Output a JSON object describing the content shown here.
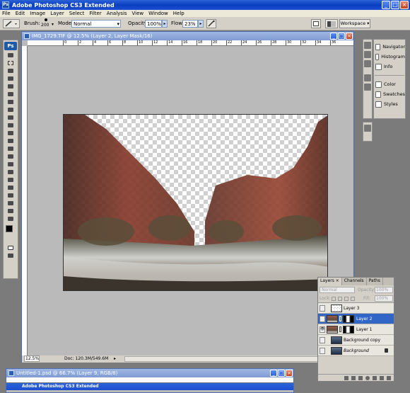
{
  "app": {
    "title": "Adobe Photoshop CS3 Extended",
    "badge": "Ps"
  },
  "window_controls": [
    "_",
    "□",
    "×"
  ],
  "menu": [
    "File",
    "Edit",
    "Image",
    "Layer",
    "Select",
    "Filter",
    "Analysis",
    "View",
    "Window",
    "Help"
  ],
  "options": {
    "brush_label": "Brush:",
    "brush_size": "200",
    "mode_label": "Mode:",
    "mode_value": "Normal",
    "opacity_label": "Opacity:",
    "opacity_value": "100%",
    "flow_label": "Flow:",
    "flow_value": "23%",
    "workspace_label": "Workspace ▾"
  },
  "document": {
    "title": "IMG_1729.TIF @ 12.5% (Layer 2, Layer Mask/16)",
    "zoom": "12.5%",
    "doc_size": "Doc: 120.3M/549.6M",
    "ruler_top": [
      "0",
      "2",
      "4",
      "6",
      "8",
      "10",
      "12",
      "14",
      "16",
      "18",
      "20",
      "22",
      "24",
      "26",
      "28",
      "30",
      "32",
      "34",
      "36"
    ]
  },
  "tools": {
    "badge": "Ps"
  },
  "panels": {
    "items": [
      "Navigator",
      "Histogram",
      "Info",
      "Color",
      "Swatches",
      "Styles"
    ]
  },
  "layers": {
    "tabs": [
      "Layers ×",
      "Channels",
      "Paths"
    ],
    "blend": "Normal",
    "opacity_label": "Opacity:",
    "opacity": "100%",
    "lock_label": "Lock:",
    "fill_label": "Fill:",
    "fill": "100%",
    "rows": [
      {
        "name": "Layer 3",
        "selected": false
      },
      {
        "name": "Layer 2",
        "selected": true
      },
      {
        "name": "Layer 1",
        "selected": false
      },
      {
        "name": "Background copy",
        "selected": false
      },
      {
        "name": "Background",
        "selected": false
      }
    ]
  },
  "document2": {
    "title": "Untitled-1.psd @ 66.7% (Layer 9, RGB/8)",
    "subtitle": "Adobe Photoshop CS3 Extended"
  }
}
